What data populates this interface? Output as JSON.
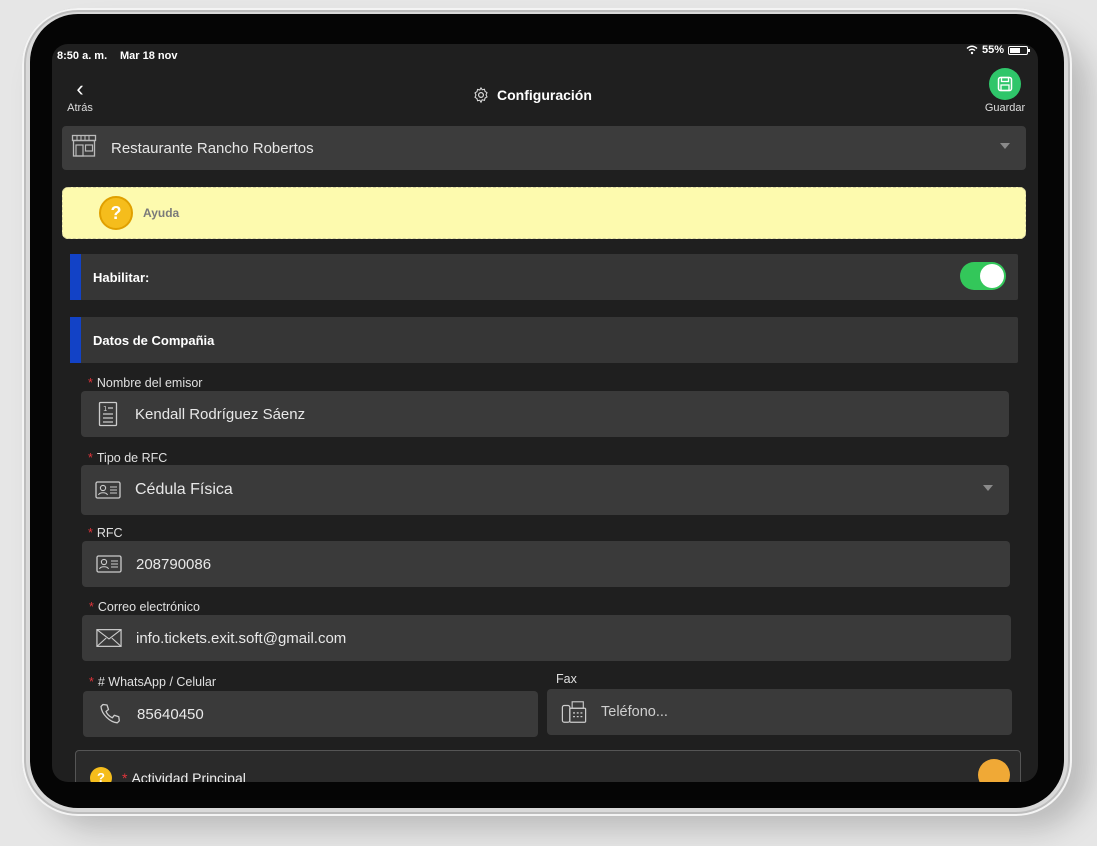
{
  "status": {
    "time": "8:50 a. m.",
    "date": "Mar 18 nov",
    "battery": "55%"
  },
  "nav": {
    "back_label": "Atrás",
    "title": "Configuración",
    "save_label": "Guardar"
  },
  "restaurant": {
    "name": "Restaurante Rancho Robertos"
  },
  "help": {
    "label": "Ayuda"
  },
  "sections": {
    "enable_label": "Habilitar:",
    "enable_on": true,
    "company_label": "Datos de Compañia"
  },
  "fields": {
    "issuer_name": {
      "label": "Nombre del emisor",
      "value": "Kendall Rodríguez Sáenz"
    },
    "rfc_type": {
      "label": "Tipo de RFC",
      "value": "Cédula Física"
    },
    "rfc": {
      "label": "RFC",
      "value": "208790086"
    },
    "email": {
      "label": "Correo electrónico",
      "value": "info.tickets.exit.soft@gmail.com"
    },
    "whatsapp": {
      "label": "# WhatsApp / Celular",
      "value": "85640450"
    },
    "fax": {
      "label": "Fax",
      "placeholder": "Teléfono..."
    }
  },
  "activity": {
    "label": "Actividad Principal"
  },
  "colors": {
    "accent_green": "#2fc66a",
    "section_bar": "#1242c6",
    "help_bg": "#fdfaae",
    "required": "#e0353b"
  }
}
